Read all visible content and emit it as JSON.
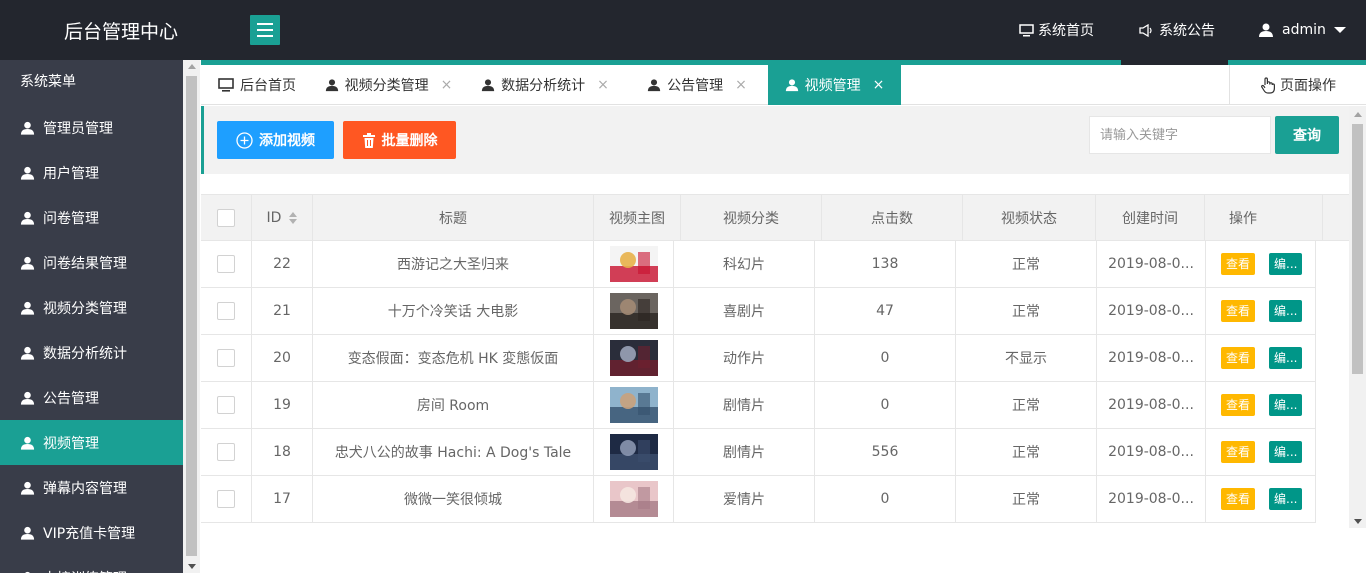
{
  "app": {
    "title": "后台管理中心"
  },
  "header": {
    "nav": [
      {
        "label": "系统首页",
        "icon": "monitor-icon"
      },
      {
        "label": "系统公告",
        "icon": "speaker-icon"
      },
      {
        "label": "admin",
        "icon": "user-icon"
      }
    ]
  },
  "sidebar": {
    "title": "系统菜单",
    "items": [
      {
        "label": "管理员管理"
      },
      {
        "label": "用户管理"
      },
      {
        "label": "问卷管理"
      },
      {
        "label": "问卷结果管理"
      },
      {
        "label": "视频分类管理"
      },
      {
        "label": "数据分析统计"
      },
      {
        "label": "公告管理"
      },
      {
        "label": "视频管理",
        "active": true
      },
      {
        "label": "弹幕内容管理"
      },
      {
        "label": "VIP充值卡管理"
      },
      {
        "label": "卡接训练管理"
      }
    ]
  },
  "tabs": {
    "items": [
      {
        "label": "后台首页"
      },
      {
        "label": "视频分类管理"
      },
      {
        "label": "数据分析统计"
      },
      {
        "label": "公告管理"
      },
      {
        "label": "视频管理",
        "active": true
      }
    ],
    "close_glyph": "×",
    "page_ops": "页面操作"
  },
  "toolbar": {
    "add_label": "添加视频",
    "delete_label": "批量删除",
    "search_placeholder": "请输入关键字",
    "search_label": "查询"
  },
  "table": {
    "columns": [
      "ID",
      "标题",
      "视频主图",
      "视频分类",
      "点击数",
      "视频状态",
      "创建时间",
      "操作"
    ],
    "view_label": "查看",
    "edit_label": "编...",
    "rows": [
      {
        "id": "22",
        "title": "西游记之大圣归来",
        "category": "科幻片",
        "clicks": "138",
        "status": "正常",
        "created": "2019-08-0..."
      },
      {
        "id": "21",
        "title": "十万个冷笑话 大电影",
        "category": "喜剧片",
        "clicks": "47",
        "status": "正常",
        "created": "2019-08-0..."
      },
      {
        "id": "20",
        "title": "变态假面：变态危机 HK 変態仮面",
        "category": "动作片",
        "clicks": "0",
        "status": "不显示",
        "created": "2019-08-0..."
      },
      {
        "id": "19",
        "title": "房间 Room",
        "category": "剧情片",
        "clicks": "0",
        "status": "正常",
        "created": "2019-08-0..."
      },
      {
        "id": "18",
        "title": "忠犬八公的故事 Hachi: A Dog's Tale",
        "category": "剧情片",
        "clicks": "556",
        "status": "正常",
        "created": "2019-08-0..."
      },
      {
        "id": "17",
        "title": "微微一笑很倾城",
        "category": "爱情片",
        "clicks": "0",
        "status": "正常",
        "created": "2019-08-0..."
      }
    ]
  },
  "colors": {
    "header_bg": "#23262e",
    "sidebar_bg": "#393d49",
    "accent": "#1aa094",
    "add_button": "#1e9fff",
    "delete_button": "#ff5722",
    "view_button": "#ffb800",
    "edit_button": "#009688"
  }
}
